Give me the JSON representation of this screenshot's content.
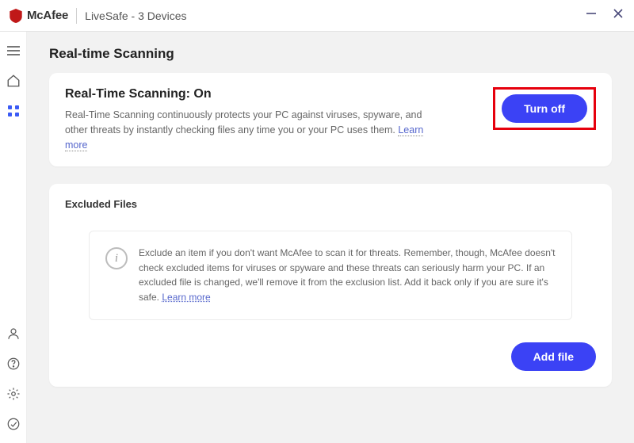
{
  "titlebar": {
    "brand": "McAfee",
    "product": "LiveSafe - 3 Devices"
  },
  "page": {
    "title": "Real-time Scanning"
  },
  "rts": {
    "heading": "Real-Time Scanning: On",
    "description": "Real-Time Scanning continuously protects your PC against viruses, spyware, and other threats by instantly checking files any time you or your PC uses them. ",
    "learn_more": "Learn more",
    "turn_off": "Turn off"
  },
  "excluded": {
    "title": "Excluded Files",
    "info": "Exclude an item if you don't want McAfee to scan it for threats. Remember, though, McAfee doesn't check excluded items for viruses or spyware and these threats can seriously harm your PC. If an excluded file is changed, we'll remove it from the exclusion list. Add it back only if you are sure it's safe. ",
    "learn_more": "Learn more",
    "add_file": "Add file"
  },
  "colors": {
    "accent": "#3b42f5",
    "highlight_border": "#e6000d",
    "brand_red": "#c01818"
  }
}
